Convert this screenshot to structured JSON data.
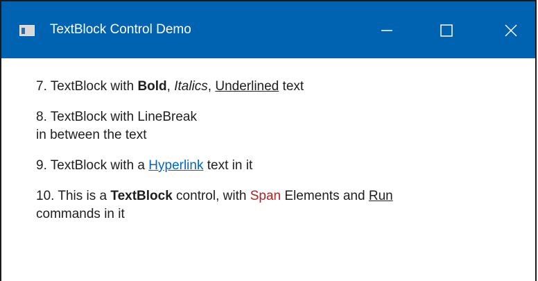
{
  "window": {
    "title": "TextBlock Control Demo",
    "titlebar_color": "#0063b1",
    "icons": {
      "app": "window-app-icon",
      "minimize": "minimize-icon",
      "maximize": "maximize-icon",
      "close": "close-icon"
    }
  },
  "items": {
    "item7": {
      "prefix": "7. TextBlock with ",
      "bold": "Bold",
      "sep1": ", ",
      "italics": "Italics",
      "sep2": ", ",
      "underlined": "Underlined",
      "suffix": " text"
    },
    "item8": {
      "line1": "8. TextBlock with LineBreak",
      "line2": "in between the text"
    },
    "item9": {
      "prefix": "9. TextBlock with a ",
      "link": "Hyperlink",
      "suffix": " text in it",
      "link_color": "#0066cc"
    },
    "item10": {
      "prefix": "10. This is a ",
      "bold": "TextBlock",
      "mid1": " control, with ",
      "span": "Span",
      "mid2": " Elements and ",
      "run": "Run",
      "line2": "commands in it",
      "span_color": "#b22222"
    }
  }
}
